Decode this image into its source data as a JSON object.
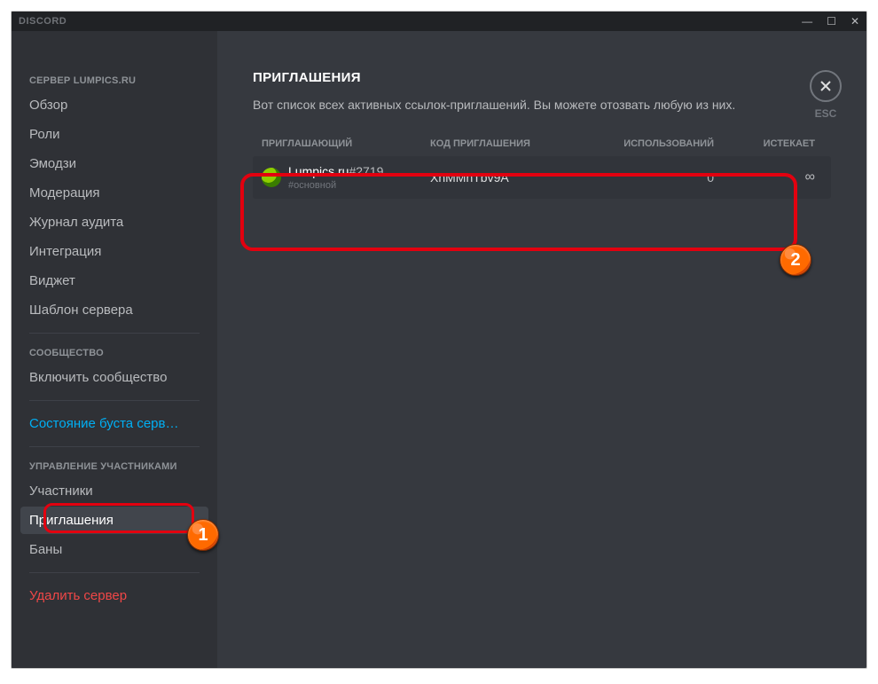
{
  "titlebar": {
    "title": "DISCORD"
  },
  "close": {
    "label": "ESC"
  },
  "sidebar": {
    "section1_header": "СЕРВЕР LUMPICS.RU",
    "section2_header": "СООБЩЕСТВО",
    "section3_header": "УПРАВЛЕНИЕ УЧАСТНИКАМИ",
    "items": {
      "overview": "Обзор",
      "roles": "Роли",
      "emoji": "Эмодзи",
      "moderation": "Модерация",
      "audit": "Журнал аудита",
      "integration": "Интеграция",
      "widget": "Виджет",
      "template": "Шаблон сервера",
      "enable_community": "Включить сообщество",
      "boost_status": "Состояние буста серв…",
      "members": "Участники",
      "invites": "Приглашения",
      "bans": "Баны",
      "delete": "Удалить сервер"
    }
  },
  "content": {
    "title": "ПРИГЛАШЕНИЯ",
    "subtitle": "Вот список всех активных ссылок-приглашений. Вы можете отозвать любую из них."
  },
  "table": {
    "headers": {
      "inviter": "ПРИГЛАШАЮЩИЙ",
      "code": "КОД ПРИГЛАШЕНИЯ",
      "uses": "ИСПОЛЬЗОВАНИЙ",
      "expires": "ИСТЕКАЕТ"
    },
    "rows": [
      {
        "inviter_name": "Lumpics.ru",
        "inviter_discriminator": "#2719",
        "channel": "#основной",
        "code": "XnMMnTbv9A",
        "uses": "0",
        "expires": "∞"
      }
    ]
  },
  "annotations": {
    "badge1": "1",
    "badge2": "2"
  }
}
